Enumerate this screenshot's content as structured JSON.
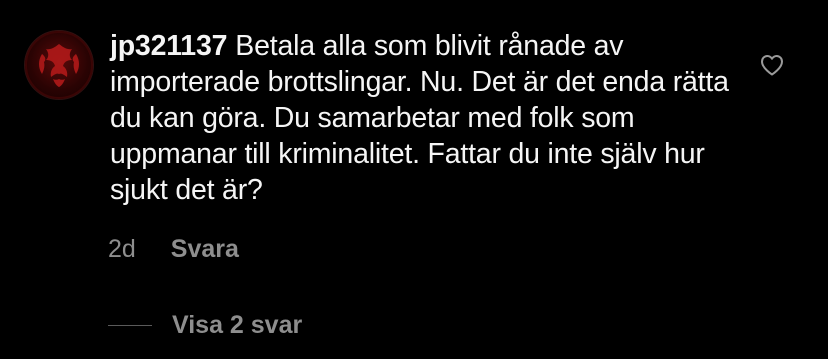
{
  "comment": {
    "username": "jp321137",
    "text": "Betala alla som blivit rånade av importerade brottslingar. Nu. Det är det enda rätta du kan göra. Du samarbetar med folk som uppmanar till kriminalitet. Fattar du inte själv hur sjukt det är?",
    "time": "2d",
    "reply_label": "Svara",
    "view_replies_label": "Visa 2 svar"
  },
  "icons": {
    "avatar": "dragon-crest-avatar",
    "like": "heart-outline-icon"
  },
  "colors": {
    "background": "#000000",
    "text": "#f5f5f5",
    "secondary_text": "#8e8e8e",
    "avatar_red": "#5a0a0a"
  }
}
